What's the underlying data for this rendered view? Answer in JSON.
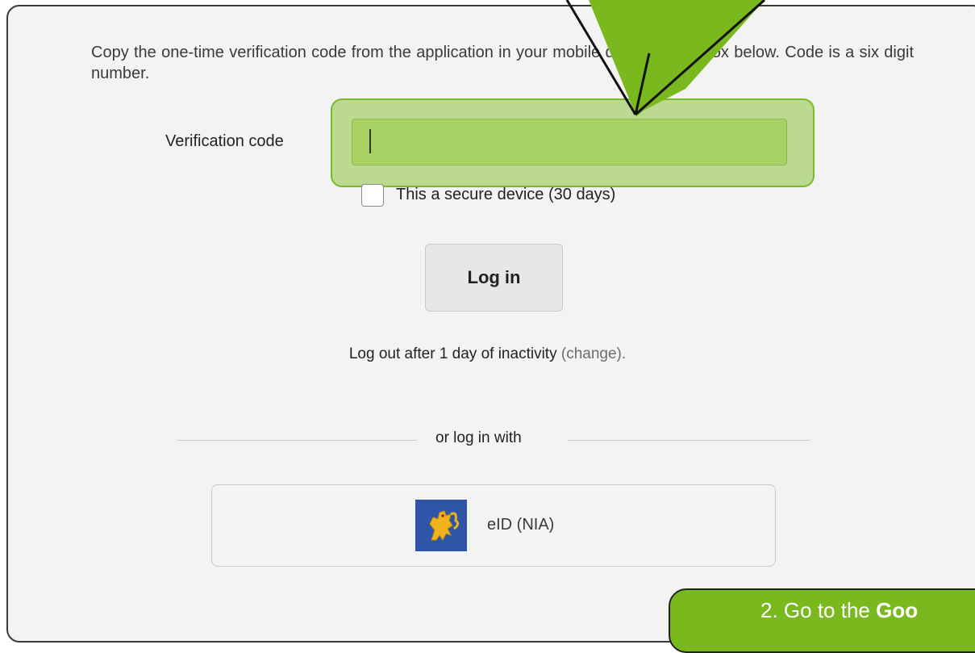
{
  "form": {
    "instructions": "Copy the one-time verification code from the application in your mobile device to the box below. Code is a six digit number.",
    "code_label": "Verification code",
    "code_value": "",
    "secure_device_label": "This a secure device (30 days)",
    "login_button": "Log in",
    "logout_prefix": "Log out after 1 day of inactivity ",
    "logout_change_open": "(",
    "logout_change_link": "change",
    "logout_change_close": ").",
    "or_login_with": "or log in with",
    "eid_button_label": "eID (NIA)"
  },
  "callout": {
    "text_prefix": "2. Go to the ",
    "text_bold": "Goo"
  },
  "colors": {
    "highlight": "#8cc33c",
    "hint_background": "#79b91e",
    "eid_logo_background": "#2f55a8"
  },
  "icons": {
    "eid_logo": "czech-lion-emblem-icon",
    "pointer": "callout-arrow-icon"
  }
}
